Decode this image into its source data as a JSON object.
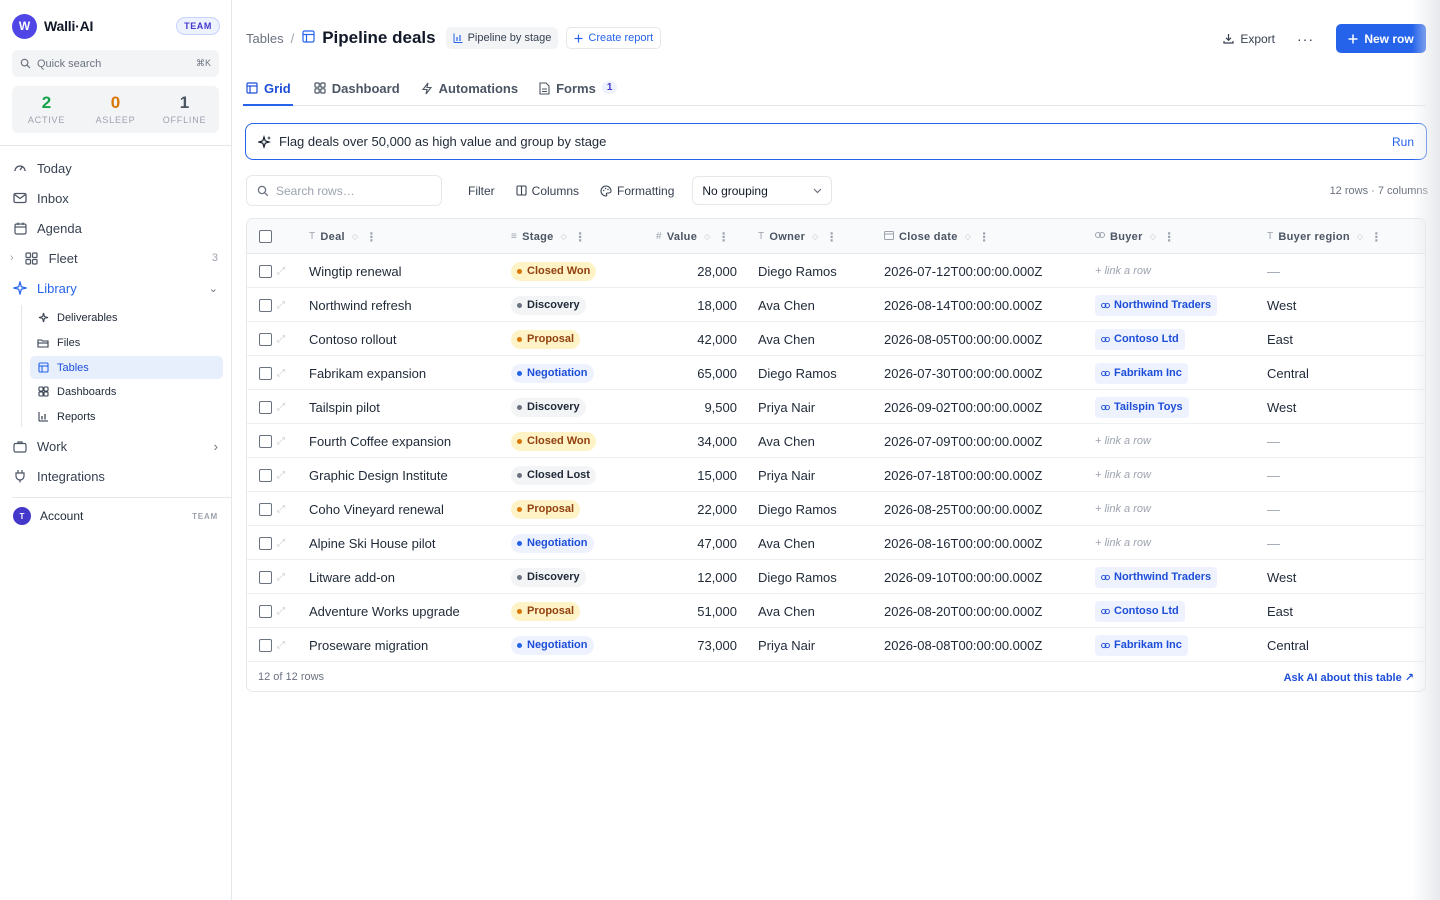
{
  "brand": {
    "logo_letter": "W",
    "name": "Walli·AI",
    "badge": "TEAM"
  },
  "quick_search": {
    "placeholder": "Quick search",
    "shortcut": "⌘K"
  },
  "stats": [
    {
      "value": "2",
      "label": "ACTIVE",
      "color": "#16a34a"
    },
    {
      "value": "0",
      "label": "ASLEEP",
      "color": "#d97706"
    },
    {
      "value": "1",
      "label": "OFFLINE",
      "color": "#4b5563"
    }
  ],
  "nav": {
    "today": "Today",
    "inbox": "Inbox",
    "agenda": "Agenda",
    "fleet": "Fleet",
    "fleet_count": "3",
    "library": "Library",
    "library_sub": [
      "Deliverables",
      "Files",
      "Tables",
      "Dashboards",
      "Reports"
    ],
    "work": "Work",
    "integrations": "Integrations"
  },
  "account": {
    "avatar": "T",
    "label": "Account",
    "tag": "TEAM"
  },
  "header": {
    "breadcrumb_root": "Tables",
    "separator": "/",
    "title": "Pipeline deals",
    "view_chip": "Pipeline by stage",
    "create_report": "Create report",
    "export": "Export",
    "more": "···",
    "new_row": "New row"
  },
  "tabs": [
    {
      "label": "Grid",
      "active": true
    },
    {
      "label": "Dashboard",
      "active": false
    },
    {
      "label": "Automations",
      "active": false
    },
    {
      "label": "Forms",
      "active": false,
      "count": "1"
    }
  ],
  "ai_bar": {
    "prompt": "Flag deals over 50,000 as high value and group by stage",
    "run": "Run"
  },
  "toolbar": {
    "search_placeholder": "Search rows…",
    "filter": "Filter",
    "columns": "Columns",
    "formatting": "Formatting",
    "grouping": "No grouping",
    "row_count": "12 rows · 7 columns"
  },
  "table": {
    "columns": [
      {
        "label": "Deal",
        "type_icon": "T"
      },
      {
        "label": "Stage",
        "type_icon": "≡"
      },
      {
        "label": "Value",
        "type_icon": "#"
      },
      {
        "label": "Owner",
        "type_icon": "T"
      },
      {
        "label": "Close date",
        "type_icon": "calendar-icon"
      },
      {
        "label": "Buyer",
        "type_icon": "link-icon"
      },
      {
        "label": "Buyer region",
        "type_icon": "T"
      }
    ],
    "link_placeholder": "+ link a row",
    "empty_value": "—",
    "stage_colors": {
      "Closed Won": {
        "bg": "#fef3c7",
        "fg": "#92400e",
        "dot": "#d97706"
      },
      "Discovery": {
        "bg": "#f3f4f6",
        "fg": "#1f2937",
        "dot": "#6b7280"
      },
      "Proposal": {
        "bg": "#fef3c7",
        "fg": "#92400e",
        "dot": "#d97706"
      },
      "Negotiation": {
        "bg": "#eef2ff",
        "fg": "#1d4ed8",
        "dot": "#2563eb"
      },
      "Closed Lost": {
        "bg": "#f3f4f6",
        "fg": "#1f2937",
        "dot": "#6b7280"
      }
    },
    "rows": [
      {
        "deal": "Wingtip renewal",
        "stage": "Closed Won",
        "value": "28,000",
        "owner": "Diego Ramos",
        "close": "2026-07-12T00:00:00.000Z",
        "buyer": "",
        "region": ""
      },
      {
        "deal": "Northwind refresh",
        "stage": "Discovery",
        "value": "18,000",
        "owner": "Ava Chen",
        "close": "2026-08-14T00:00:00.000Z",
        "buyer": "Northwind Traders",
        "region": "West"
      },
      {
        "deal": "Contoso rollout",
        "stage": "Proposal",
        "value": "42,000",
        "owner": "Ava Chen",
        "close": "2026-08-05T00:00:00.000Z",
        "buyer": "Contoso Ltd",
        "region": "East"
      },
      {
        "deal": "Fabrikam expansion",
        "stage": "Negotiation",
        "value": "65,000",
        "owner": "Diego Ramos",
        "close": "2026-07-30T00:00:00.000Z",
        "buyer": "Fabrikam Inc",
        "region": "Central"
      },
      {
        "deal": "Tailspin pilot",
        "stage": "Discovery",
        "value": "9,500",
        "owner": "Priya Nair",
        "close": "2026-09-02T00:00:00.000Z",
        "buyer": "Tailspin Toys",
        "region": "West"
      },
      {
        "deal": "Fourth Coffee expansion",
        "stage": "Closed Won",
        "value": "34,000",
        "owner": "Ava Chen",
        "close": "2026-07-09T00:00:00.000Z",
        "buyer": "",
        "region": ""
      },
      {
        "deal": "Graphic Design Institute",
        "stage": "Closed Lost",
        "value": "15,000",
        "owner": "Priya Nair",
        "close": "2026-07-18T00:00:00.000Z",
        "buyer": "",
        "region": ""
      },
      {
        "deal": "Coho Vineyard renewal",
        "stage": "Proposal",
        "value": "22,000",
        "owner": "Diego Ramos",
        "close": "2026-08-25T00:00:00.000Z",
        "buyer": "",
        "region": ""
      },
      {
        "deal": "Alpine Ski House pilot",
        "stage": "Negotiation",
        "value": "47,000",
        "owner": "Ava Chen",
        "close": "2026-08-16T00:00:00.000Z",
        "buyer": "",
        "region": ""
      },
      {
        "deal": "Litware add-on",
        "stage": "Discovery",
        "value": "12,000",
        "owner": "Diego Ramos",
        "close": "2026-09-10T00:00:00.000Z",
        "buyer": "Northwind Traders",
        "region": "West"
      },
      {
        "deal": "Adventure Works upgrade",
        "stage": "Proposal",
        "value": "51,000",
        "owner": "Ava Chen",
        "close": "2026-08-20T00:00:00.000Z",
        "buyer": "Contoso Ltd",
        "region": "East"
      },
      {
        "deal": "Proseware migration",
        "stage": "Negotiation",
        "value": "73,000",
        "owner": "Priya Nair",
        "close": "2026-08-08T00:00:00.000Z",
        "buyer": "Fabrikam Inc",
        "region": "Central"
      }
    ],
    "footer_count": "12 of 12 rows",
    "ask_ai": "Ask AI about this table ↗"
  },
  "colors": {
    "accent": "#2563eb",
    "brand": "#4f46e5"
  }
}
